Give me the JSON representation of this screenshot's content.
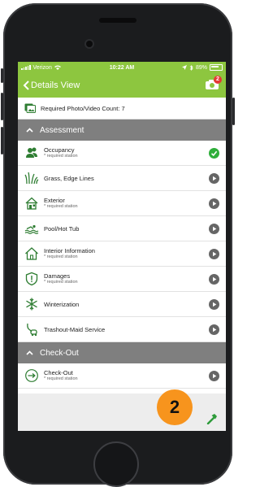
{
  "status_bar": {
    "carrier": "Verizon",
    "time": "10:22 AM",
    "battery": "89%"
  },
  "nav": {
    "back_label": "Details View",
    "photo_badge_count": "2"
  },
  "required": {
    "label": "Required Photo/Video Count: 7"
  },
  "sections": [
    {
      "title": "Assessment",
      "items": [
        {
          "title": "Occupancy",
          "subtitle": "* required station",
          "icon": "people-icon",
          "status": "complete"
        },
        {
          "title": "Grass, Edge Lines",
          "subtitle": "",
          "icon": "grass-icon",
          "status": "pending"
        },
        {
          "title": "Exterior",
          "subtitle": "* required station",
          "icon": "house-exterior-icon",
          "status": "pending"
        },
        {
          "title": "Pool/Hot Tub",
          "subtitle": "",
          "icon": "swimmer-icon",
          "status": "pending"
        },
        {
          "title": "Interior Information",
          "subtitle": "* required station",
          "icon": "house-interior-icon",
          "status": "pending"
        },
        {
          "title": "Damages",
          "subtitle": "* required station",
          "icon": "shield-alert-icon",
          "status": "pending"
        },
        {
          "title": "Winterization",
          "subtitle": "",
          "icon": "snowflake-icon",
          "status": "pending"
        },
        {
          "title": "Trashout-Maid Service",
          "subtitle": "",
          "icon": "vacuum-icon",
          "status": "pending"
        }
      ]
    },
    {
      "title": "Check-Out",
      "items": [
        {
          "title": "Check-Out",
          "subtitle": "* required station",
          "icon": "exit-arrow-icon",
          "status": "pending"
        }
      ]
    }
  ],
  "step_marker": "2",
  "colors": {
    "brand_green": "#8dc63f",
    "section_gray": "#7f7f7f",
    "complete_green": "#2eae3a",
    "pending_gray": "#666666",
    "marker_orange": "#f7941d"
  }
}
